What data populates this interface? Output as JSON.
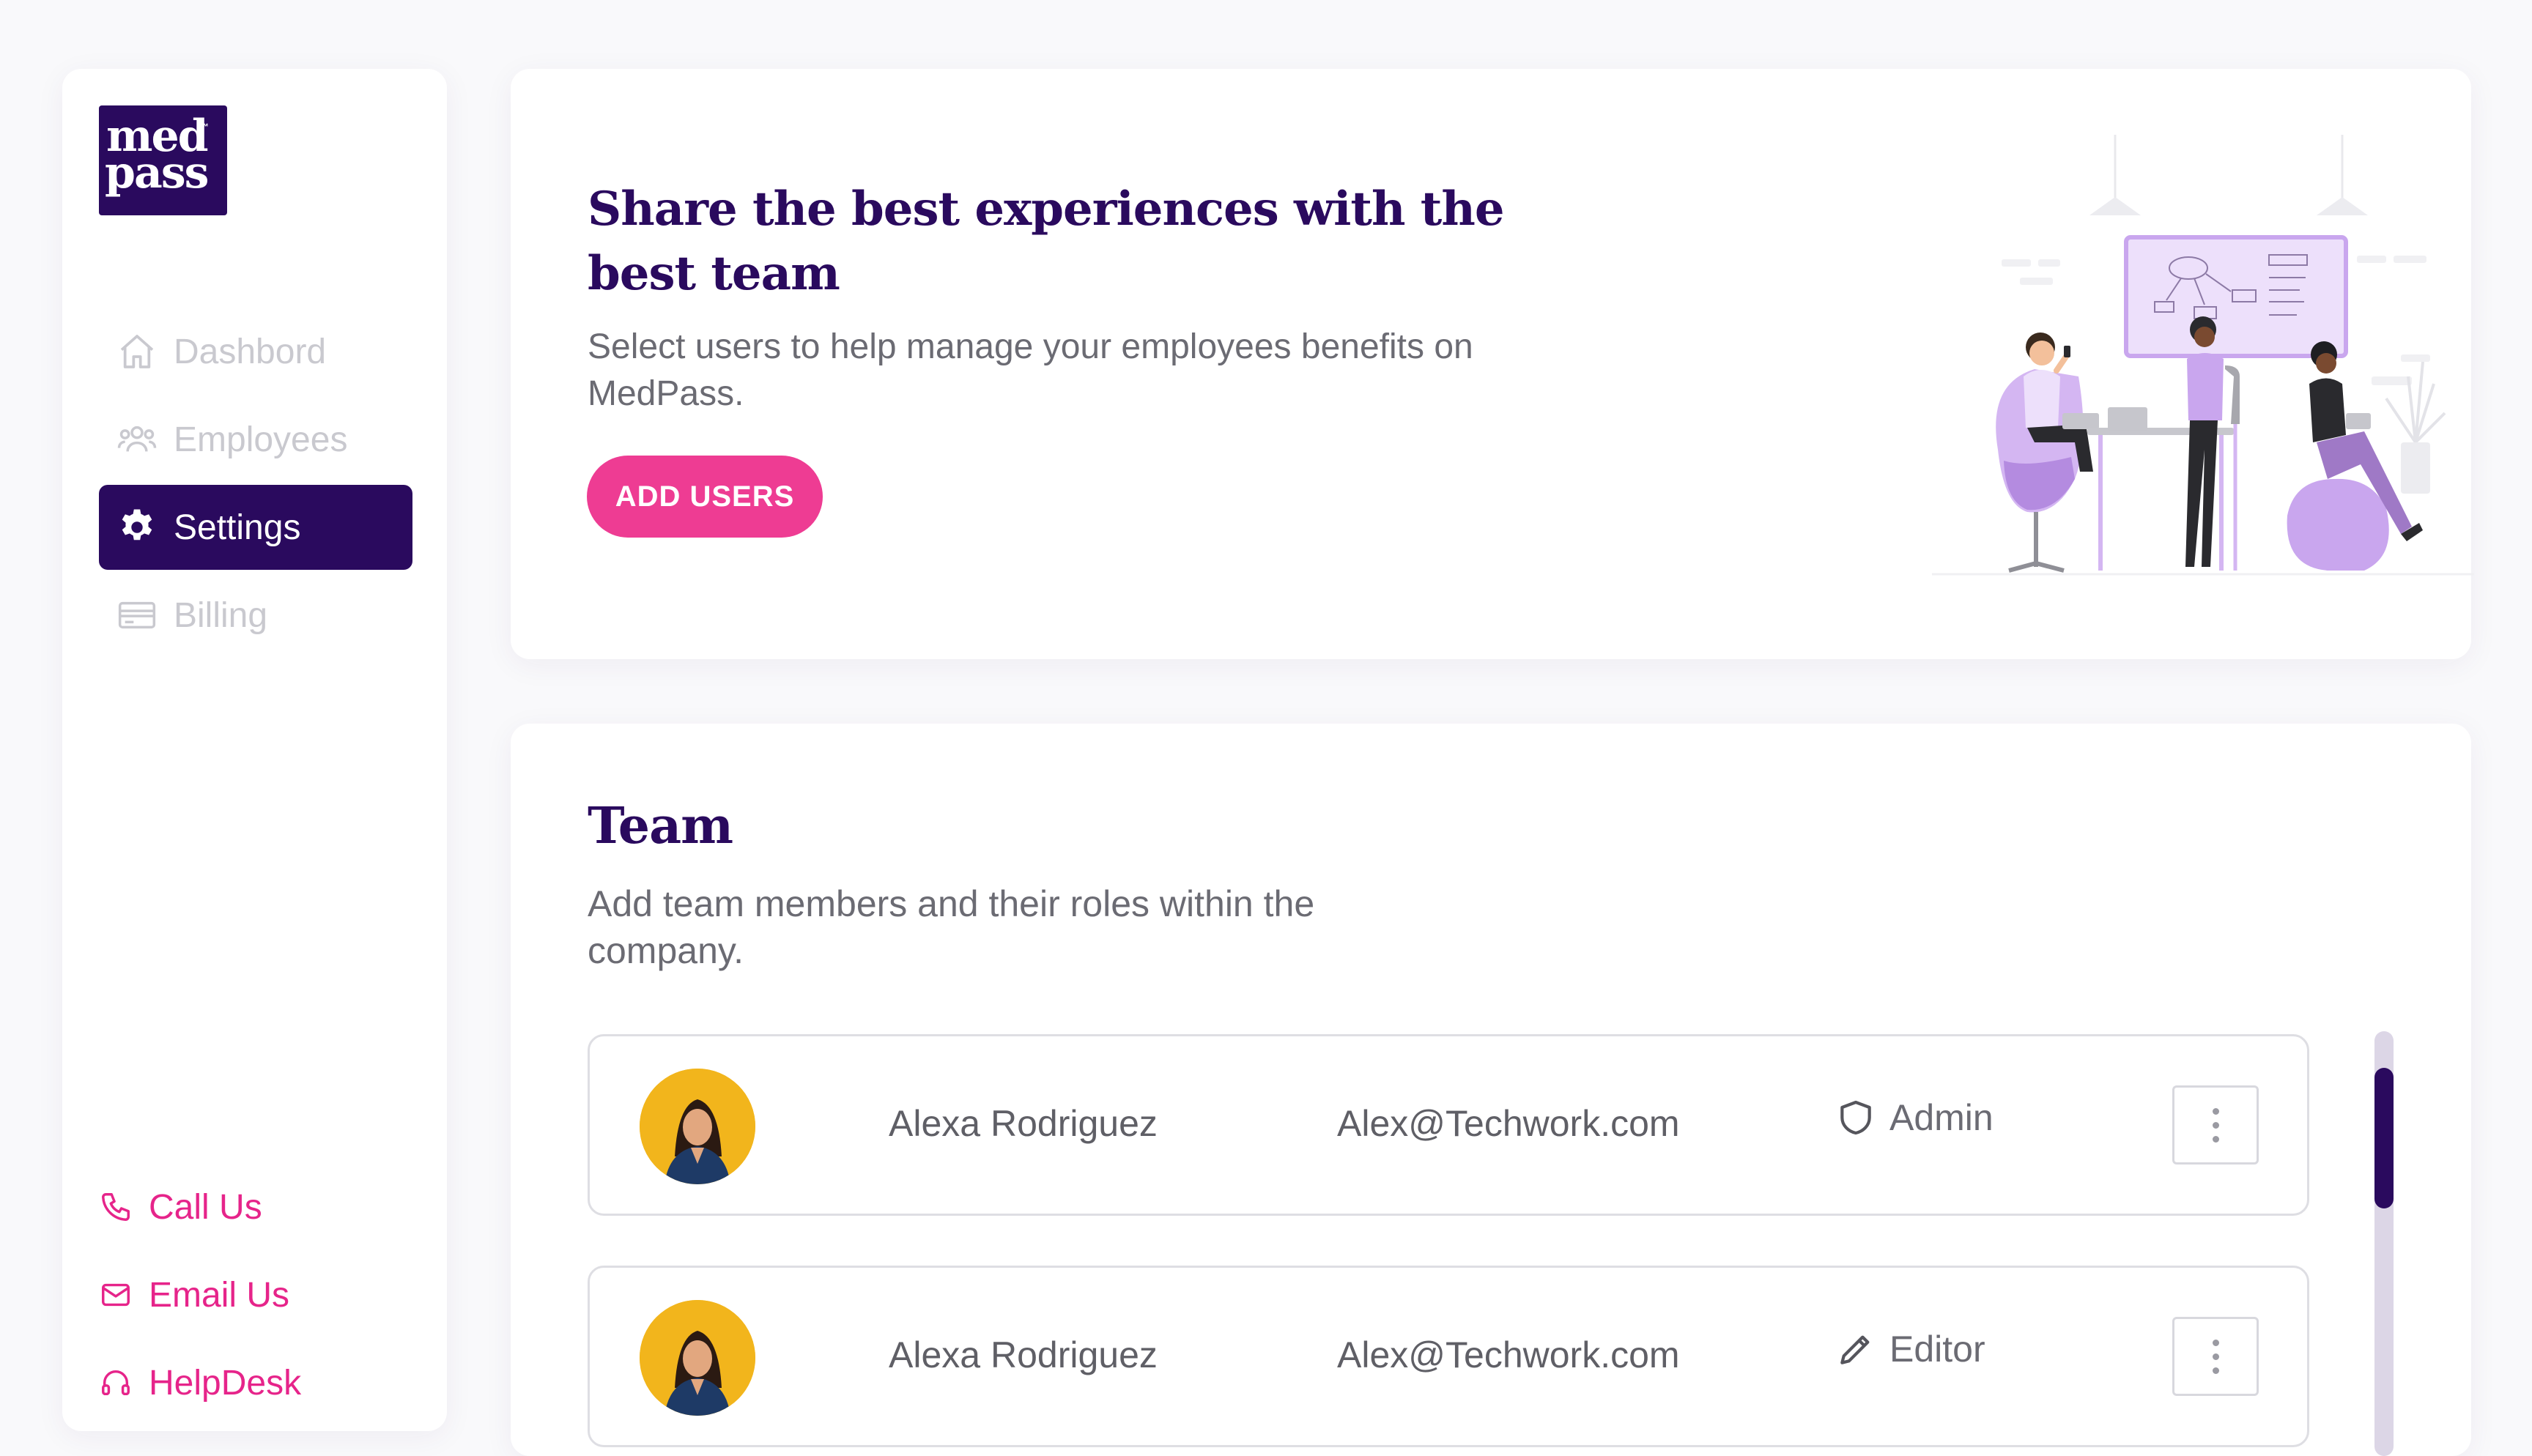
{
  "brand": {
    "logo_line1": "med",
    "logo_line2": "pass",
    "logo_mark": "™"
  },
  "nav": {
    "items": [
      {
        "label": "Dashbord",
        "icon": "home-icon",
        "active": false
      },
      {
        "label": "Employees",
        "icon": "users-icon",
        "active": false
      },
      {
        "label": "Settings",
        "icon": "gear-icon",
        "active": true
      },
      {
        "label": "Billing",
        "icon": "credit-card-icon",
        "active": false
      }
    ]
  },
  "support": {
    "items": [
      {
        "label": "Call Us",
        "icon": "phone-icon"
      },
      {
        "label": "Email Us",
        "icon": "mail-icon"
      },
      {
        "label": "HelpDesk",
        "icon": "headset-icon"
      }
    ]
  },
  "hero": {
    "title": "Share the best experiences with the best team",
    "subtitle": "Select users to help manage your employees benefits on MedPass.",
    "button_label": "ADD USERS"
  },
  "team": {
    "title": "Team",
    "subtitle": "Add team members and their roles within the company.",
    "members": [
      {
        "name": "Alexa Rodriguez",
        "email": "Alex@Techwork.com",
        "role": "Admin",
        "role_icon": "shield-icon"
      },
      {
        "name": "Alexa Rodriguez",
        "email": "Alex@Techwork.com",
        "role": "Editor",
        "role_icon": "pencil-icon"
      }
    ]
  },
  "colors": {
    "brand_purple": "#2a0a5e",
    "accent_pink": "#ee3c93",
    "link_pink": "#e6248a",
    "illustration_lilac": "#c9a6ee",
    "avatar_yellow": "#f2b51c"
  }
}
